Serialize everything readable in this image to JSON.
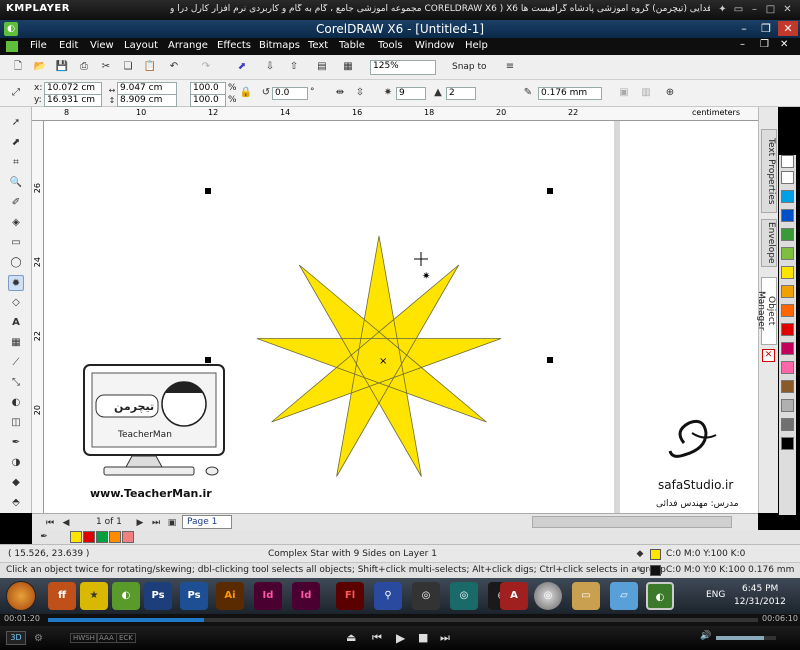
{
  "player": {
    "logo": "KMPLAYER",
    "title": "مجموعه آموزشی جامع ، گام به گام و کاربردی نرم افزار کارل درا و CORELDRAW X6 ) X6   مدرس : سعید فدایی (تیچرمن) گروه آموزشی پادشاه گرافیست ها",
    "time_current": "00:01:20",
    "time_total": "00:06:10",
    "progress": 0.22,
    "mode_labels": [
      "3D"
    ],
    "quality_labels": [
      "HWSH",
      "AAA",
      "ECK"
    ]
  },
  "window": {
    "title": "CorelDRAW X6 - [Untitled-1]"
  },
  "menu": [
    "File",
    "Edit",
    "View",
    "Layout",
    "Arrange",
    "Effects",
    "Bitmaps",
    "Text",
    "Table",
    "Tools",
    "Window",
    "Help"
  ],
  "toolbar": {
    "zoom": "125%",
    "snap_label": "Snap to"
  },
  "propbar": {
    "x_label": "x:",
    "x": "10.072 cm",
    "y_label": "y:",
    "y": "16.931 cm",
    "w": "9.047 cm",
    "h": "8.909 cm",
    "scale_x": "100.0",
    "scale_y": "100.0",
    "pct": "%",
    "rotation": "0.0",
    "rotation_unit": "°",
    "points": "9",
    "sharpness": "2",
    "outline": "0.176 mm"
  },
  "ruler": {
    "units": "centimeters",
    "h_ticks": [
      "8",
      "10",
      "12",
      "14",
      "16",
      "18",
      "20",
      "22"
    ],
    "v_ticks": [
      "26",
      "24",
      "22",
      "20"
    ]
  },
  "docker": {
    "tabs": [
      "Text Properties",
      "Envelope",
      "Object Manager"
    ]
  },
  "canvas": {
    "star_fill": "#ffe400",
    "watermark_site": "www.TeacherMan.ir",
    "watermark_name": "TeacherMan",
    "watermark_persian": "تیچرمن",
    "studio": "safaStudio.ir",
    "studio_teacher": "مدرس: مهندس فدائی"
  },
  "pagebar": {
    "page_counter": "1 of 1",
    "page_tab": "Page 1"
  },
  "status": {
    "coords": "( 15.526, 23.639 )",
    "object": "Complex Star with 9 Sides on Layer 1",
    "hint": "Click an object twice for rotating/skewing; dbl-clicking tool selects all objects; Shift+click multi-selects; Alt+click digs; Ctrl+click selects in a group",
    "fill_label": "C:0 M:0 Y:100 K:0",
    "fill_color": "#ffe400",
    "outline_label": "C:0 M:0 Y:0 K:100  0.176 mm",
    "outline_color": "#111111"
  },
  "taskbar": {
    "lang": "ENG",
    "time": "6:45 PM",
    "date": "12/31/2012",
    "apps": [
      "firefox-icon",
      "star-icon",
      "coreldraw-icon",
      "photoshop-icon",
      "photoshop-icon-2",
      "illustrator-icon",
      "indesign-icon",
      "indesign-icon-2",
      "flash-icon",
      "tool-icon",
      "app-icon",
      "app-icon-2",
      "app-icon-3",
      "acrobat-icon",
      "dvd-icon",
      "folder-icon",
      "notepad-icon",
      "coreldraw-active-icon"
    ]
  },
  "palette_colors": [
    "#ffffff",
    "#00a0e6",
    "#0050c8",
    "#3a9a3a",
    "#7fbf3f",
    "#ffe400",
    "#f0a000",
    "#ff6600",
    "#e00000",
    "#c0005a",
    "#ff66aa",
    "#8a5a2a",
    "#b0b0b0",
    "#707070",
    "#000000"
  ],
  "doc_palette": [
    "#ffe400",
    "#e00000",
    "#00a040",
    "#ff8c00",
    "#f08080"
  ]
}
